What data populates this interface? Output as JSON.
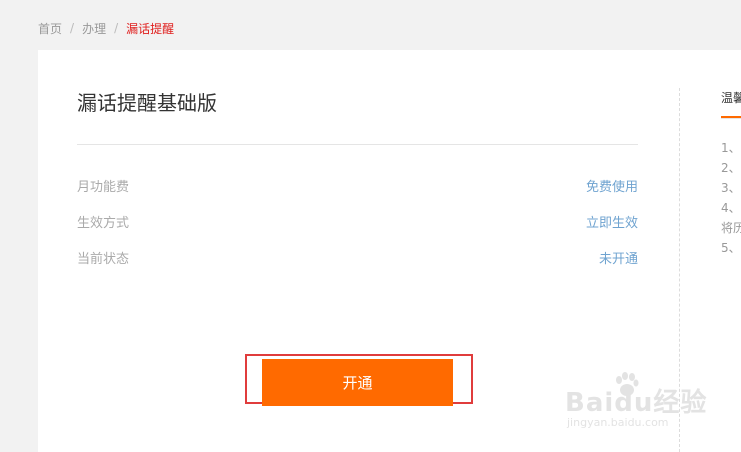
{
  "breadcrumb": {
    "items": [
      "首页",
      "办理"
    ],
    "separator": "/",
    "current": "漏话提醒"
  },
  "product": {
    "title": "漏话提醒基础版",
    "rows": [
      {
        "label": "月功能费",
        "value": "免费使用"
      },
      {
        "label": "生效方式",
        "value": "立即生效"
      },
      {
        "label": "当前状态",
        "value": "未开通"
      }
    ],
    "open_button": "开通"
  },
  "tips": {
    "title": "温馨",
    "lines": [
      "1、",
      "2、",
      "3、",
      "4、",
      "将历",
      "5、"
    ]
  },
  "watermark": {
    "main": "Baidu经验",
    "sub": "jingyan.baidu.com"
  },
  "colors": {
    "accent": "#ff6a00",
    "link": "#6fa3d0",
    "breadcrumb_current": "#e0201f",
    "highlight_box": "#e03c3c"
  }
}
